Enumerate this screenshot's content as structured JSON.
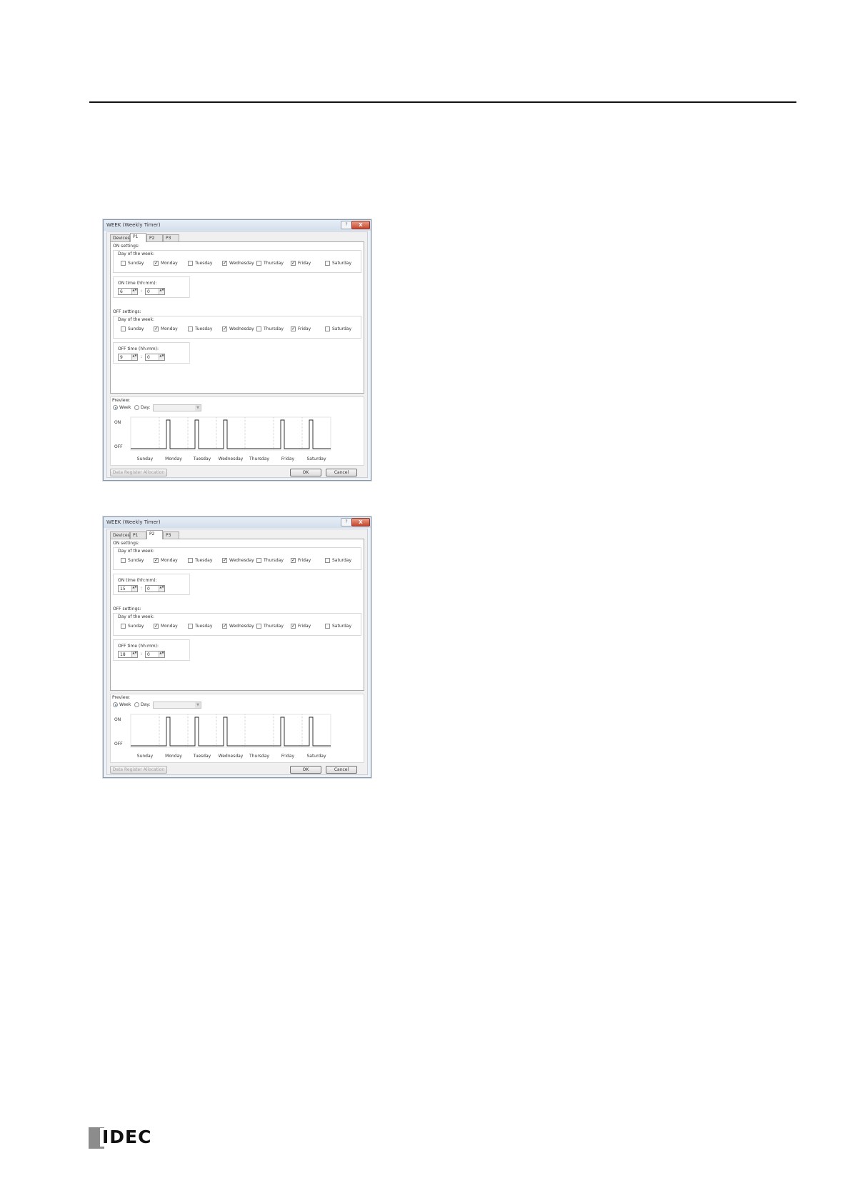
{
  "logo": {
    "text": "IDEC"
  },
  "dialogs": [
    {
      "title": "WEEK (Weekly Timer)",
      "help": "?",
      "close": "X",
      "tabs": [
        "Devices",
        "P1",
        "P2",
        "P3"
      ],
      "active_tab": "P1",
      "on_settings": {
        "group_label": "ON settings:",
        "dow_label": "Day of the week:",
        "days": [
          {
            "label": "Sunday",
            "checked": false
          },
          {
            "label": "Monday",
            "checked": true
          },
          {
            "label": "Tuesday",
            "checked": false
          },
          {
            "label": "Wednesday",
            "checked": true
          },
          {
            "label": "Thursday",
            "checked": false
          },
          {
            "label": "Friday",
            "checked": true
          },
          {
            "label": "Saturday",
            "checked": false
          }
        ],
        "time_label": "ON time (hh:mm):",
        "hour": "6",
        "minute": "0"
      },
      "off_settings": {
        "group_label": "OFF settings:",
        "dow_label": "Day of the week:",
        "days": [
          {
            "label": "Sunday",
            "checked": false
          },
          {
            "label": "Monday",
            "checked": true
          },
          {
            "label": "Tuesday",
            "checked": false
          },
          {
            "label": "Wednesday",
            "checked": true
          },
          {
            "label": "Thursday",
            "checked": false
          },
          {
            "label": "Friday",
            "checked": true
          },
          {
            "label": "Saturday",
            "checked": false
          }
        ],
        "time_label": "OFF time (hh:mm):",
        "hour": "9",
        "minute": "0"
      },
      "preview": {
        "label": "Preview:",
        "week_label": "Week",
        "day_label": "Day:",
        "week_selected": true,
        "on_label": "ON",
        "off_label": "OFF"
      },
      "chart_data": {
        "type": "line",
        "x_unit": "hour of week (0-168)",
        "categories": [
          "Sunday",
          "Monday",
          "Tuesday",
          "Wednesday",
          "Thursday",
          "Friday",
          "Saturday"
        ],
        "series": [
          {
            "values": [
              [
                0,
                0
              ],
              [
                30,
                0
              ],
              [
                30,
                1
              ],
              [
                33,
                1
              ],
              [
                33,
                0
              ],
              [
                54,
                0
              ],
              [
                54,
                1
              ],
              [
                57,
                1
              ],
              [
                57,
                0
              ],
              [
                78,
                0
              ],
              [
                78,
                1
              ],
              [
                81,
                1
              ],
              [
                81,
                0
              ],
              [
                126,
                0
              ],
              [
                126,
                1
              ],
              [
                129,
                1
              ],
              [
                129,
                0
              ],
              [
                150,
                0
              ],
              [
                150,
                1
              ],
              [
                153,
                1
              ],
              [
                153,
                0
              ],
              [
                168,
                0
              ]
            ]
          }
        ],
        "ylabels": [
          "ON",
          "OFF"
        ]
      },
      "buttons": {
        "data_register": "Data Register Allocation",
        "ok": "OK",
        "cancel": "Cancel"
      }
    },
    {
      "title": "WEEK (Weekly Timer)",
      "help": "?",
      "close": "X",
      "tabs": [
        "Devices",
        "P1",
        "P2",
        "P3"
      ],
      "active_tab": "P2",
      "on_settings": {
        "group_label": "ON settings:",
        "dow_label": "Day of the week:",
        "days": [
          {
            "label": "Sunday",
            "checked": false
          },
          {
            "label": "Monday",
            "checked": true
          },
          {
            "label": "Tuesday",
            "checked": false
          },
          {
            "label": "Wednesday",
            "checked": true
          },
          {
            "label": "Thursday",
            "checked": false
          },
          {
            "label": "Friday",
            "checked": true
          },
          {
            "label": "Saturday",
            "checked": false
          }
        ],
        "time_label": "ON time (hh:mm):",
        "hour": "15",
        "minute": "0"
      },
      "off_settings": {
        "group_label": "OFF settings:",
        "dow_label": "Day of the week:",
        "days": [
          {
            "label": "Sunday",
            "checked": false
          },
          {
            "label": "Monday",
            "checked": true
          },
          {
            "label": "Tuesday",
            "checked": false
          },
          {
            "label": "Wednesday",
            "checked": true
          },
          {
            "label": "Thursday",
            "checked": false
          },
          {
            "label": "Friday",
            "checked": true
          },
          {
            "label": "Saturday",
            "checked": false
          }
        ],
        "time_label": "OFF time (hh:mm):",
        "hour": "18",
        "minute": "0"
      },
      "preview": {
        "label": "Preview:",
        "week_label": "Week",
        "day_label": "Day:",
        "week_selected": true,
        "on_label": "ON",
        "off_label": "OFF"
      },
      "chart_data": {
        "type": "line",
        "x_unit": "hour of week (0-168)",
        "categories": [
          "Sunday",
          "Monday",
          "Tuesday",
          "Wednesday",
          "Thursday",
          "Friday",
          "Saturday"
        ],
        "series": [
          {
            "values": [
              [
                0,
                0
              ],
              [
                30,
                0
              ],
              [
                30,
                1
              ],
              [
                33,
                1
              ],
              [
                33,
                0
              ],
              [
                54,
                0
              ],
              [
                54,
                1
              ],
              [
                57,
                1
              ],
              [
                57,
                0
              ],
              [
                78,
                0
              ],
              [
                78,
                1
              ],
              [
                81,
                1
              ],
              [
                81,
                0
              ],
              [
                126,
                0
              ],
              [
                126,
                1
              ],
              [
                129,
                1
              ],
              [
                129,
                0
              ],
              [
                150,
                0
              ],
              [
                150,
                1
              ],
              [
                153,
                1
              ],
              [
                153,
                0
              ],
              [
                168,
                0
              ]
            ]
          }
        ],
        "ylabels": [
          "ON",
          "OFF"
        ]
      },
      "buttons": {
        "data_register": "Data Register Allocation",
        "ok": "OK",
        "cancel": "Cancel"
      }
    }
  ]
}
